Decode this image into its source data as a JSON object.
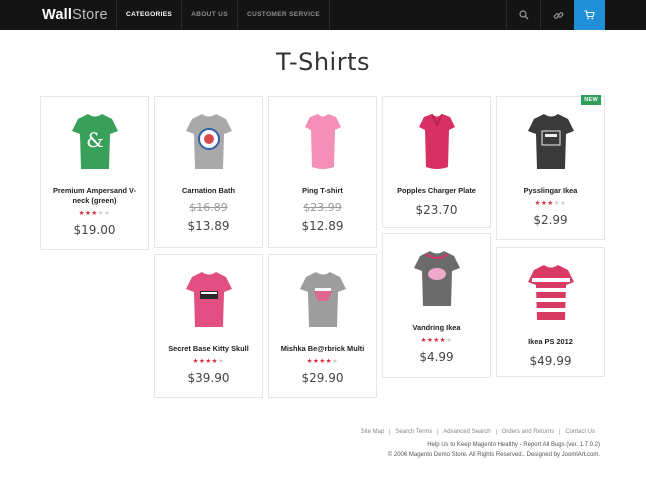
{
  "header": {
    "logo_bold": "Wall",
    "logo_light": "Store",
    "nav": [
      {
        "label": "CATEGORIES",
        "active": true
      },
      {
        "label": "ABOUT US",
        "active": false
      },
      {
        "label": "CUSTOMER SERVICE",
        "active": false
      }
    ],
    "icons": [
      "search-icon",
      "link-icon",
      "cart-icon"
    ],
    "accent_color": "#1f8fd8"
  },
  "page_title": "T-Shirts",
  "products": [
    {
      "name_line1": "Premium Ampersand V-",
      "name_line2": "neck (green)",
      "stars": 3,
      "old_price": "",
      "price": "$19.00",
      "badge": "",
      "shirt_color": "#39a05a",
      "print_color": "#ffffff"
    },
    {
      "name_line1": "Carnation Bath",
      "name_line2": "",
      "stars": 0,
      "old_price": "$16.89",
      "price": "$13.89",
      "badge": "",
      "shirt_color": "#a9a9a9",
      "print_color": "#2f5fa8"
    },
    {
      "name_line1": "Ping T-shirt",
      "name_line2": "",
      "stars": 0,
      "old_price": "$23.99",
      "price": "$12.89",
      "badge": "",
      "shirt_color": "#f48fb7",
      "print_color": "#f48fb7"
    },
    {
      "name_line1": "Popples Charger Plate",
      "name_line2": "",
      "stars": 0,
      "old_price": "",
      "price": "$23.70",
      "badge": "",
      "shirt_color": "#d63065",
      "print_color": "#d63065"
    },
    {
      "name_line1": "Pysslingar Ikea",
      "name_line2": "",
      "stars": 3,
      "old_price": "",
      "price": "$2.99",
      "badge": "NEW",
      "shirt_color": "#3a3a3a",
      "print_color": "#eeeeee"
    },
    {
      "name_line1": "Secret Base Kitty Skull",
      "name_line2": "",
      "stars": 3.5,
      "old_price": "",
      "price": "$39.90",
      "badge": "",
      "shirt_color": "#e25083",
      "print_color": "#2a2a2a"
    },
    {
      "name_line1": "Mishka Be@rbrick Multi",
      "name_line2": "",
      "stars": 4,
      "old_price": "",
      "price": "$29.90",
      "badge": "",
      "shirt_color": "#9d9d9d",
      "print_color": "#e0668f"
    },
    {
      "name_line1": "Vandring Ikea",
      "name_line2": "",
      "stars": 3.5,
      "old_price": "",
      "price": "$4.99",
      "badge": "",
      "shirt_color": "#6b6b6b",
      "print_color": "#f0a9c8"
    },
    {
      "name_line1": "Ikea PS 2012",
      "name_line2": "",
      "stars": 0,
      "old_price": "",
      "price": "$49.99",
      "badge": "",
      "shirt_color": "#d83a64",
      "print_color": "#ffffff"
    }
  ],
  "footer": {
    "links": [
      "Site Map",
      "Search Terms",
      "Advanced Search",
      "Orders and Returns",
      "Contact Us"
    ],
    "help_prefix": "Help Us to Keep Magento Healthy - ",
    "help_link": "Report All Bugs",
    "help_suffix": " (ver. 1.7.0.2)",
    "copyright_prefix": "© 2006 Magento Demo Store. All Rights Reserved.. Designed by ",
    "copyright_link": "JoomlArt.com",
    "copyright_suffix": "."
  }
}
